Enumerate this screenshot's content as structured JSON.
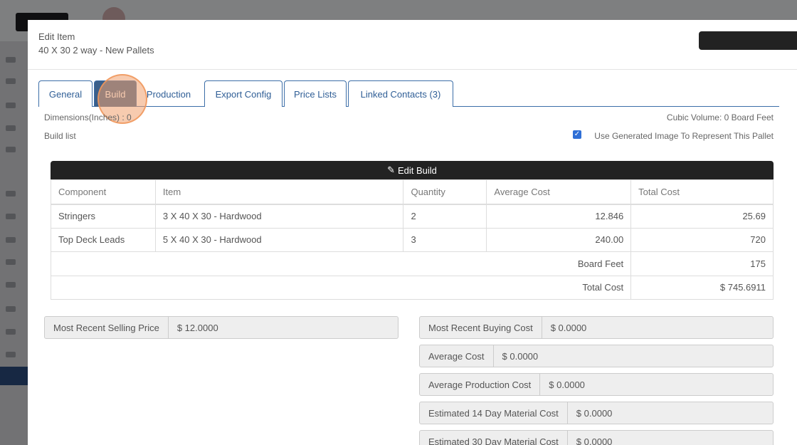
{
  "modal": {
    "title": "Edit Item",
    "subtitle": "40 X 30 2 way - New Pallets"
  },
  "tabs": [
    {
      "label": "General"
    },
    {
      "label": "Build"
    },
    {
      "label": "Production"
    },
    {
      "label": "Export Config"
    },
    {
      "label": "Price Lists"
    },
    {
      "label": "Linked Contacts (3)"
    }
  ],
  "build": {
    "dimensions": "Dimensions(Inches) : 0",
    "cubic_volume": "Cubic Volume: 0 Board Feet",
    "build_list_label": "Build list",
    "use_generated_image": "Use Generated Image To Represent This Pallet",
    "edit_build_label": "Edit Build",
    "columns": [
      "Component",
      "Item",
      "Quantity",
      "Average Cost",
      "Total Cost"
    ],
    "rows": [
      {
        "component": "Stringers",
        "item": "3 X 40 X 30 - Hardwood",
        "quantity": "2",
        "avg_cost": "12.846",
        "total_cost": "25.69"
      },
      {
        "component": "Top Deck Leads",
        "item": "5 X 40 X 30 - Hardwood",
        "quantity": "3",
        "avg_cost": "240.00",
        "total_cost": "720"
      }
    ],
    "board_feet_label": "Board Feet",
    "board_feet_value": "175",
    "total_cost_label": "Total Cost",
    "total_cost_value": "$ 745.6911"
  },
  "prices": {
    "most_recent_selling": {
      "label": "Most Recent Selling Price",
      "value": "$ 12.0000"
    },
    "most_recent_buying": {
      "label": "Most Recent Buying Cost",
      "value": "$ 0.0000"
    },
    "average_cost": {
      "label": "Average Cost",
      "value": "$ 0.0000"
    },
    "average_production": {
      "label": "Average Production Cost",
      "value": "$ 0.0000"
    },
    "est_14": {
      "label": "Estimated 14 Day Material Cost",
      "value": "$ 0.0000"
    },
    "est_30": {
      "label": "Estimated 30 Day Material Cost",
      "value": "$ 0.0000"
    }
  },
  "colors": {
    "active_tab": "#3a5f8a",
    "tab_border": "#3c6ea8",
    "edit_build_bar": "#222222",
    "checkbox": "#2f6fd6"
  }
}
